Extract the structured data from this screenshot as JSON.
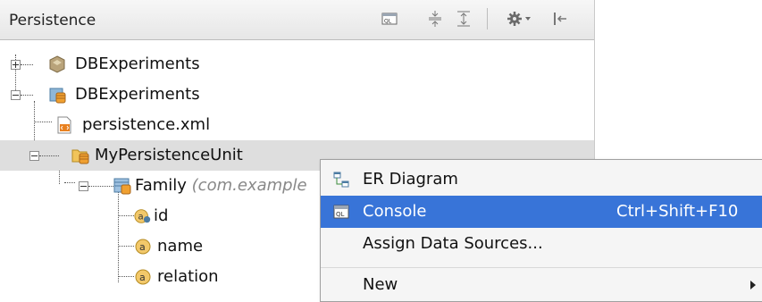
{
  "panel": {
    "title": "Persistence",
    "toolbar": [
      {
        "name": "ql-console-icon"
      },
      {
        "name": "expand-all-icon"
      },
      {
        "name": "collapse-all-icon"
      },
      {
        "name": "gear-icon"
      },
      {
        "name": "hide-panel-icon"
      }
    ]
  },
  "tree": {
    "items": [
      {
        "label": "DBExperiments",
        "hint": ""
      },
      {
        "label": "DBExperiments",
        "hint": ""
      },
      {
        "label": "persistence.xml",
        "hint": ""
      },
      {
        "label": "MyPersistenceUnit",
        "hint": ""
      },
      {
        "label": "Family",
        "hint": "(com.example"
      },
      {
        "label": "id",
        "hint": ""
      },
      {
        "label": "name",
        "hint": ""
      },
      {
        "label": "relation",
        "hint": ""
      }
    ]
  },
  "menu": {
    "items": [
      {
        "label": "ER Diagram",
        "shortcut": ""
      },
      {
        "label": "Console",
        "shortcut": "Ctrl+Shift+F10"
      },
      {
        "label": "Assign Data Sources...",
        "shortcut": ""
      },
      {
        "label": "New",
        "shortcut": ""
      }
    ]
  },
  "colors": {
    "selection": "#dedede",
    "menu_highlight": "#3874d8"
  }
}
